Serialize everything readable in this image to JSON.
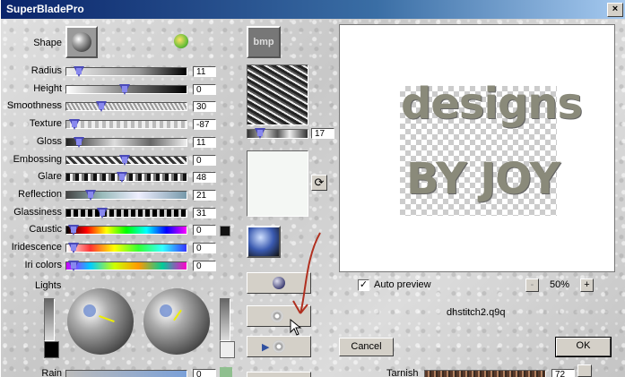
{
  "window": {
    "title": "SuperBladePro",
    "close_label": "×"
  },
  "shape": {
    "label": "Shape"
  },
  "sliders": [
    {
      "label": "Radius",
      "value": "11",
      "pos": 0.11
    },
    {
      "label": "Height",
      "value": "0",
      "pos": 0.5
    },
    {
      "label": "Smoothness",
      "value": "30",
      "pos": 0.3
    },
    {
      "label": "Texture",
      "value": "-87",
      "pos": 0.07
    },
    {
      "label": "Gloss",
      "value": "11",
      "pos": 0.11
    },
    {
      "label": "Embossing",
      "value": "0",
      "pos": 0.5
    },
    {
      "label": "Glare",
      "value": "48",
      "pos": 0.48
    },
    {
      "label": "Reflection",
      "value": "21",
      "pos": 0.21
    },
    {
      "label": "Glassiness",
      "value": "31",
      "pos": 0.31
    },
    {
      "label": "Caustic",
      "value": "0",
      "pos": 0.0
    },
    {
      "label": "Iridescence",
      "value": "0",
      "pos": 0.0
    },
    {
      "label": "Iri colors",
      "value": "0",
      "pos": 0.0
    }
  ],
  "lights": {
    "label": "Lights"
  },
  "rain": {
    "label": "Rain",
    "value": "0"
  },
  "texture": {
    "bmp_label": "bmp",
    "value": "17"
  },
  "preview": {
    "line1": "designs",
    "line2": "BY JOY"
  },
  "auto_preview": {
    "label": "Auto preview",
    "checked": true
  },
  "zoom": {
    "minus": "-",
    "value": "50%",
    "plus": "+"
  },
  "filename": "dhstitch2.q9q",
  "buttons": {
    "cancel": "Cancel",
    "ok": "OK"
  },
  "tarnish": {
    "label": "Tarnish",
    "value": "72"
  }
}
